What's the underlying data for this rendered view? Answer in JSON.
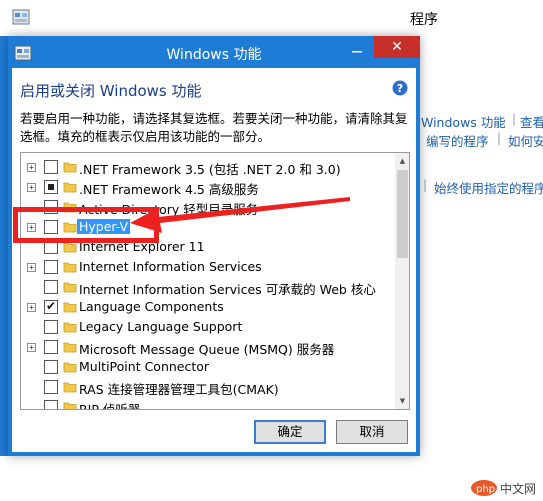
{
  "background_window": {
    "title": "程序",
    "links": [
      {
        "text": "Windows 功能"
      },
      {
        "text": "查看"
      },
      {
        "text": "编写的程序"
      },
      {
        "text": "如何安装"
      },
      {
        "text": "始终使用指定的程序"
      }
    ]
  },
  "dialog": {
    "title": "Windows 功能",
    "close_label": "✕",
    "heading": "启用或关闭 Windows 功能",
    "description": "若要启用一种功能，请选择其复选框。若要关闭一种功能，请清除其复选框。填充的框表示仅启用该功能的一部分。",
    "features": [
      {
        "label": ".NET Framework 3.5 (包括 .NET 2.0 和 3.0)",
        "expander": "+",
        "state": "unchecked"
      },
      {
        "label": ".NET Framework 4.5 高级服务",
        "expander": "+",
        "state": "partial"
      },
      {
        "label": "Active Directory 轻型目录服务",
        "expander": "",
        "state": "unchecked"
      },
      {
        "label": "Hyper-V",
        "expander": "+",
        "state": "unchecked",
        "selected": true
      },
      {
        "label": "Internet Explorer 11",
        "expander": "",
        "state": "unchecked"
      },
      {
        "label": "Internet Information Services",
        "expander": "+",
        "state": "unchecked"
      },
      {
        "label": "Internet Information Services 可承载的 Web 核心",
        "expander": "",
        "state": "unchecked"
      },
      {
        "label": "Language Components",
        "expander": "+",
        "state": "checked"
      },
      {
        "label": "Legacy Language Support",
        "expander": "",
        "state": "unchecked"
      },
      {
        "label": "Microsoft Message Queue (MSMQ) 服务器",
        "expander": "+",
        "state": "unchecked"
      },
      {
        "label": "MultiPoint Connector",
        "expander": "",
        "state": "unchecked"
      },
      {
        "label": "RAS 连接管理器管理工具包(CMAK)",
        "expander": "",
        "state": "unchecked"
      },
      {
        "label": "RIP 侦听器",
        "expander": "",
        "state": "unchecked"
      }
    ],
    "ok_label": "确定",
    "cancel_label": "取消"
  },
  "colors": {
    "accent": "#1f7cd6",
    "selection": "#3297fd",
    "annotation": "#ee2121",
    "close": "#c7302a"
  }
}
